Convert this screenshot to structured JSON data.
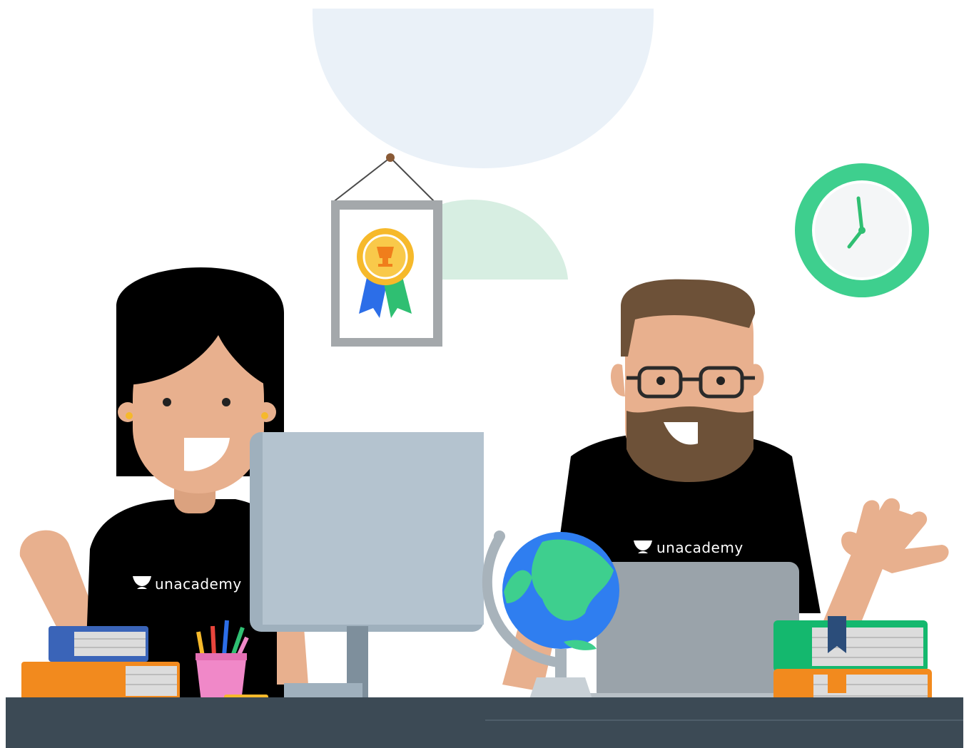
{
  "brand": {
    "left_shirt_text": "unacademy",
    "right_shirt_text": "unacademy"
  },
  "colors": {
    "background": "#ffffff",
    "desk": "#3c4a55",
    "skin": "#e8b08e",
    "hair": "#000000",
    "beard": "#6d5138",
    "shirt": "#000000",
    "monitor": "#b4c3cf",
    "laptop": "#9aa3aa",
    "clock_ring": "#3ecf8e",
    "globe_water": "#2f7ef0",
    "globe_land": "#3ecf8e",
    "bowl": "#eaf1f8",
    "mint_shape": "#d7eee2",
    "award_gold": "#f6b92b",
    "award_ribbon_blue": "#2c6ee8",
    "award_ribbon_green": "#2fbf72",
    "book_blue": "#3a64b8",
    "book_orange": "#f28a1e",
    "book_green": "#14b86e",
    "pencil_cup": "#f088c8"
  },
  "icons": [
    "clock-icon",
    "award-medal-icon",
    "globe-icon",
    "brand-logo-icon"
  ]
}
